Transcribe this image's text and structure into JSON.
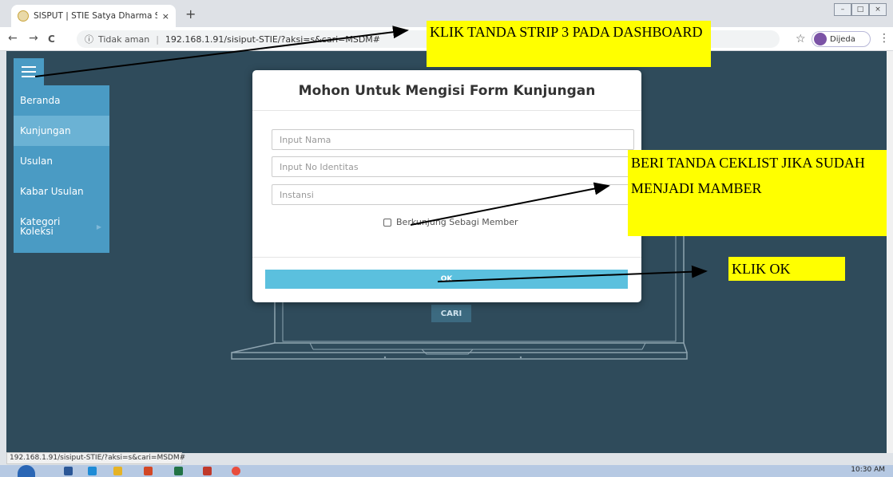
{
  "browser": {
    "tab_title": "SISPUT | STIE Satya Dharma Singa",
    "tab_close": "×",
    "new_tab": "+",
    "nav_back": "←",
    "nav_forward": "→",
    "nav_reload": "C",
    "security_info": "ⓘ",
    "security_text": "Tidak aman",
    "url": "192.168.1.91/sisiput-STIE/?aksi=s&cari=MSDM#",
    "bookmark_star": "☆",
    "profile_label": "Dijeda",
    "menu_kebab": "⋮",
    "status_url": "192.168.1.91/sisiput-STIE/?aksi=s&cari=MSDM#"
  },
  "sidebar": {
    "items": [
      {
        "label": "Beranda"
      },
      {
        "label": "Kunjungan"
      },
      {
        "label": "Usulan"
      },
      {
        "label": "Kabar Usulan"
      },
      {
        "label": "Kategori Koleksi"
      }
    ],
    "submenu_arrow": "▶"
  },
  "page": {
    "search_button": "CARI"
  },
  "modal": {
    "title": "Mohon Untuk Mengisi Form Kunjungan",
    "fields": [
      {
        "placeholder": "Input Nama"
      },
      {
        "placeholder": "Input No Identitas"
      },
      {
        "placeholder": "Instansi"
      }
    ],
    "member_checkbox_label": "Berkunjung Sebagi Member",
    "ok_label": "OK"
  },
  "annotations": {
    "note1": "KLIK TANDA STRIP 3 PADA DASHBOARD",
    "note2": "BERI TANDA CEKLIST JIKA SUDAH MENJADI MAMBER",
    "note3": "KLIK OK"
  },
  "taskbar": {
    "clock": "10:30 AM"
  },
  "colors": {
    "page_bg": "#2f4b5b",
    "sidebar": "#4a9bc4",
    "ok_button": "#5bc0de",
    "annotation": "#ffff00"
  }
}
